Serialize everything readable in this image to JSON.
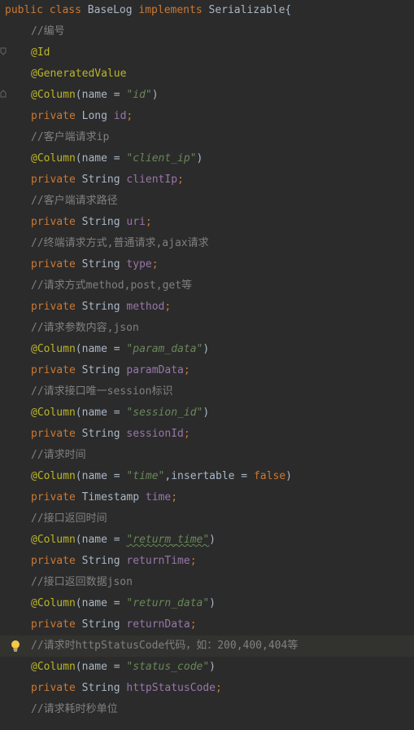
{
  "code": {
    "class_decl": {
      "kw1": "public",
      "kw2": "class",
      "name": "BaseLog",
      "kw3": "implements",
      "iface": "Serializable",
      "brace": "{"
    },
    "lines": [
      {
        "comment": "//编号"
      },
      {
        "annotation": "@Id"
      },
      {
        "annotation": "@GeneratedValue"
      },
      {
        "annotation": "@Column",
        "params": "(name = ",
        "value": "\"id\"",
        "close": ")"
      },
      {
        "modifier": "private",
        "type": "Long",
        "field": "id",
        "end": ";"
      },
      {
        "comment": "//客户端请求ip"
      },
      {
        "annotation": "@Column",
        "params": "(name = ",
        "value": "\"client_ip\"",
        "close": ")"
      },
      {
        "modifier": "private",
        "type": "String",
        "field": "clientIp",
        "end": ";"
      },
      {
        "comment": "//客户端请求路径"
      },
      {
        "modifier": "private",
        "type": "String",
        "field": "uri",
        "end": ";"
      },
      {
        "comment": "//终端请求方式,普通请求,ajax请求"
      },
      {
        "modifier": "private",
        "type": "String",
        "field": "type",
        "end": ";"
      },
      {
        "comment": "//请求方式method,post,get等"
      },
      {
        "modifier": "private",
        "type": "String",
        "field": "method",
        "end": ";"
      },
      {
        "comment": "//请求参数内容,json"
      },
      {
        "annotation": "@Column",
        "params": "(name = ",
        "value": "\"param_data\"",
        "close": ")"
      },
      {
        "modifier": "private",
        "type": "String",
        "field": "paramData",
        "end": ";"
      },
      {
        "comment": "//请求接口唯一session标识"
      },
      {
        "annotation": "@Column",
        "params": "(name = ",
        "value": "\"session_id\"",
        "close": ")"
      },
      {
        "modifier": "private",
        "type": "String",
        "field": "sessionId",
        "end": ";"
      },
      {
        "comment": "//请求时间"
      },
      {
        "annotation": "@Column",
        "params": "(name = ",
        "value": "\"time\"",
        "extra": ",insertable = ",
        "extra_kw": "false",
        "close": ")"
      },
      {
        "modifier": "private",
        "type": "Timestamp",
        "field": "time",
        "end": ";"
      },
      {
        "comment": "//接口返回时间"
      },
      {
        "annotation": "@Column",
        "params": "(name = ",
        "value": "\"returm_time\"",
        "close": ")"
      },
      {
        "modifier": "private",
        "type": "String",
        "field": "returnTime",
        "end": ";"
      },
      {
        "comment": "//接口返回数据json"
      },
      {
        "annotation": "@Column",
        "params": "(name = ",
        "value": "\"return_data\"",
        "close": ")"
      },
      {
        "modifier": "private",
        "type": "String",
        "field": "returnData",
        "end": ";"
      },
      {
        "comment": "//请求时httpStatusCode代码，如：200,400,404等"
      },
      {
        "annotation": "@Column",
        "params": "(name = ",
        "value": "\"status_code\"",
        "close": ")"
      },
      {
        "modifier": "private",
        "type": "String",
        "field": "httpStatusCode",
        "end": ";"
      },
      {
        "comment": "//请求耗时秒单位"
      }
    ]
  },
  "icons": {
    "gutter_fold": "fold-marker-icon",
    "intention": "lightbulb-icon"
  },
  "colors": {
    "background": "#2b2b2b",
    "keyword": "#cc7832",
    "annotation": "#bbb529",
    "string": "#6a8759",
    "field": "#9876aa",
    "comment": "#808080",
    "text": "#a9b7c6"
  }
}
